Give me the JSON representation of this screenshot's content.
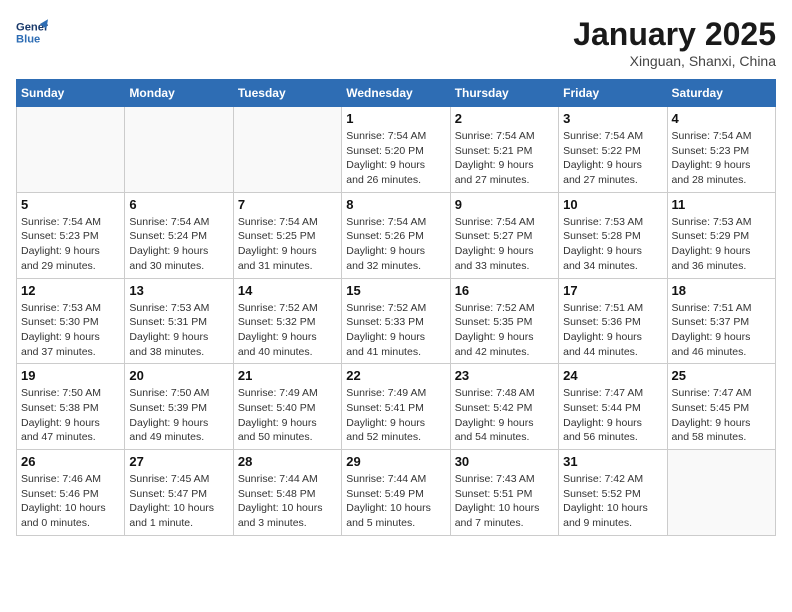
{
  "header": {
    "logo_line1": "General",
    "logo_line2": "Blue",
    "month": "January 2025",
    "location": "Xinguan, Shanxi, China"
  },
  "weekdays": [
    "Sunday",
    "Monday",
    "Tuesday",
    "Wednesday",
    "Thursday",
    "Friday",
    "Saturday"
  ],
  "weeks": [
    [
      {
        "day": "",
        "info": ""
      },
      {
        "day": "",
        "info": ""
      },
      {
        "day": "",
        "info": ""
      },
      {
        "day": "1",
        "info": "Sunrise: 7:54 AM\nSunset: 5:20 PM\nDaylight: 9 hours\nand 26 minutes."
      },
      {
        "day": "2",
        "info": "Sunrise: 7:54 AM\nSunset: 5:21 PM\nDaylight: 9 hours\nand 27 minutes."
      },
      {
        "day": "3",
        "info": "Sunrise: 7:54 AM\nSunset: 5:22 PM\nDaylight: 9 hours\nand 27 minutes."
      },
      {
        "day": "4",
        "info": "Sunrise: 7:54 AM\nSunset: 5:23 PM\nDaylight: 9 hours\nand 28 minutes."
      }
    ],
    [
      {
        "day": "5",
        "info": "Sunrise: 7:54 AM\nSunset: 5:23 PM\nDaylight: 9 hours\nand 29 minutes."
      },
      {
        "day": "6",
        "info": "Sunrise: 7:54 AM\nSunset: 5:24 PM\nDaylight: 9 hours\nand 30 minutes."
      },
      {
        "day": "7",
        "info": "Sunrise: 7:54 AM\nSunset: 5:25 PM\nDaylight: 9 hours\nand 31 minutes."
      },
      {
        "day": "8",
        "info": "Sunrise: 7:54 AM\nSunset: 5:26 PM\nDaylight: 9 hours\nand 32 minutes."
      },
      {
        "day": "9",
        "info": "Sunrise: 7:54 AM\nSunset: 5:27 PM\nDaylight: 9 hours\nand 33 minutes."
      },
      {
        "day": "10",
        "info": "Sunrise: 7:53 AM\nSunset: 5:28 PM\nDaylight: 9 hours\nand 34 minutes."
      },
      {
        "day": "11",
        "info": "Sunrise: 7:53 AM\nSunset: 5:29 PM\nDaylight: 9 hours\nand 36 minutes."
      }
    ],
    [
      {
        "day": "12",
        "info": "Sunrise: 7:53 AM\nSunset: 5:30 PM\nDaylight: 9 hours\nand 37 minutes."
      },
      {
        "day": "13",
        "info": "Sunrise: 7:53 AM\nSunset: 5:31 PM\nDaylight: 9 hours\nand 38 minutes."
      },
      {
        "day": "14",
        "info": "Sunrise: 7:52 AM\nSunset: 5:32 PM\nDaylight: 9 hours\nand 40 minutes."
      },
      {
        "day": "15",
        "info": "Sunrise: 7:52 AM\nSunset: 5:33 PM\nDaylight: 9 hours\nand 41 minutes."
      },
      {
        "day": "16",
        "info": "Sunrise: 7:52 AM\nSunset: 5:35 PM\nDaylight: 9 hours\nand 42 minutes."
      },
      {
        "day": "17",
        "info": "Sunrise: 7:51 AM\nSunset: 5:36 PM\nDaylight: 9 hours\nand 44 minutes."
      },
      {
        "day": "18",
        "info": "Sunrise: 7:51 AM\nSunset: 5:37 PM\nDaylight: 9 hours\nand 46 minutes."
      }
    ],
    [
      {
        "day": "19",
        "info": "Sunrise: 7:50 AM\nSunset: 5:38 PM\nDaylight: 9 hours\nand 47 minutes."
      },
      {
        "day": "20",
        "info": "Sunrise: 7:50 AM\nSunset: 5:39 PM\nDaylight: 9 hours\nand 49 minutes."
      },
      {
        "day": "21",
        "info": "Sunrise: 7:49 AM\nSunset: 5:40 PM\nDaylight: 9 hours\nand 50 minutes."
      },
      {
        "day": "22",
        "info": "Sunrise: 7:49 AM\nSunset: 5:41 PM\nDaylight: 9 hours\nand 52 minutes."
      },
      {
        "day": "23",
        "info": "Sunrise: 7:48 AM\nSunset: 5:42 PM\nDaylight: 9 hours\nand 54 minutes."
      },
      {
        "day": "24",
        "info": "Sunrise: 7:47 AM\nSunset: 5:44 PM\nDaylight: 9 hours\nand 56 minutes."
      },
      {
        "day": "25",
        "info": "Sunrise: 7:47 AM\nSunset: 5:45 PM\nDaylight: 9 hours\nand 58 minutes."
      }
    ],
    [
      {
        "day": "26",
        "info": "Sunrise: 7:46 AM\nSunset: 5:46 PM\nDaylight: 10 hours\nand 0 minutes."
      },
      {
        "day": "27",
        "info": "Sunrise: 7:45 AM\nSunset: 5:47 PM\nDaylight: 10 hours\nand 1 minute."
      },
      {
        "day": "28",
        "info": "Sunrise: 7:44 AM\nSunset: 5:48 PM\nDaylight: 10 hours\nand 3 minutes."
      },
      {
        "day": "29",
        "info": "Sunrise: 7:44 AM\nSunset: 5:49 PM\nDaylight: 10 hours\nand 5 minutes."
      },
      {
        "day": "30",
        "info": "Sunrise: 7:43 AM\nSunset: 5:51 PM\nDaylight: 10 hours\nand 7 minutes."
      },
      {
        "day": "31",
        "info": "Sunrise: 7:42 AM\nSunset: 5:52 PM\nDaylight: 10 hours\nand 9 minutes."
      },
      {
        "day": "",
        "info": ""
      }
    ]
  ]
}
